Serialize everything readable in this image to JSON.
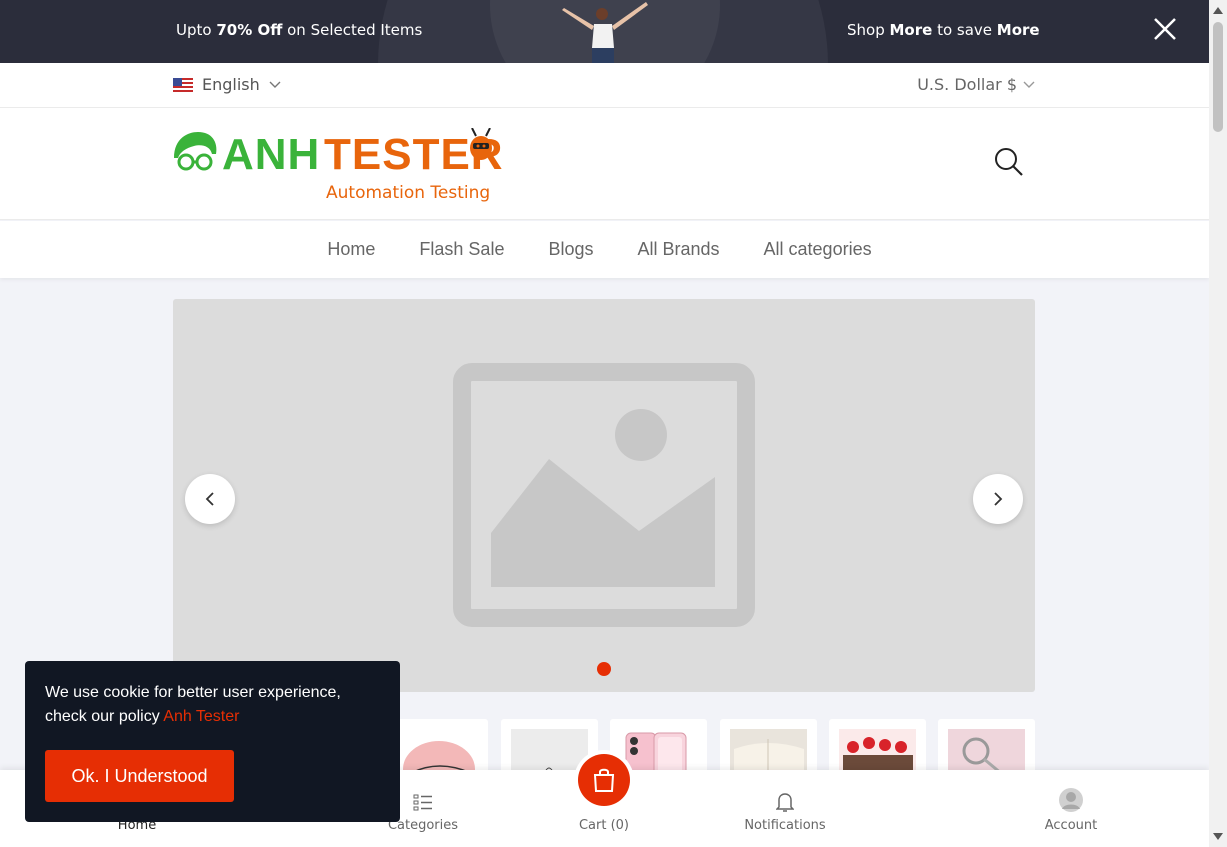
{
  "promo": {
    "left_prefix": "Upto ",
    "left_bold": "70% Off",
    "left_suffix": " on Selected Items",
    "right_prefix": "Shop ",
    "right_bold1": "More",
    "right_mid": " to save ",
    "right_bold2": "More",
    "bg_color": "#2b2d3b"
  },
  "topbar": {
    "language": "English",
    "currency": "U.S. Dollar $"
  },
  "logo": {
    "brand_part1": "ANH",
    "brand_part2": "TESTER",
    "tagline": "Automation Testing"
  },
  "nav": {
    "items": [
      "Home",
      "Flash Sale",
      "Blogs",
      "All Brands",
      "All categories"
    ]
  },
  "bottom_nav": {
    "home": "Home",
    "categories": "Categories",
    "cart": "Cart (0)",
    "notifications": "Notifications",
    "account": "Account"
  },
  "cookie": {
    "message": "We use cookie for better user experience, check our policy ",
    "policy_link": "Anh Tester",
    "button": "Ok. I Understood"
  },
  "colors": {
    "accent": "#e62e04",
    "brand_green": "#3ab33a",
    "brand_orange": "#e8650c"
  }
}
